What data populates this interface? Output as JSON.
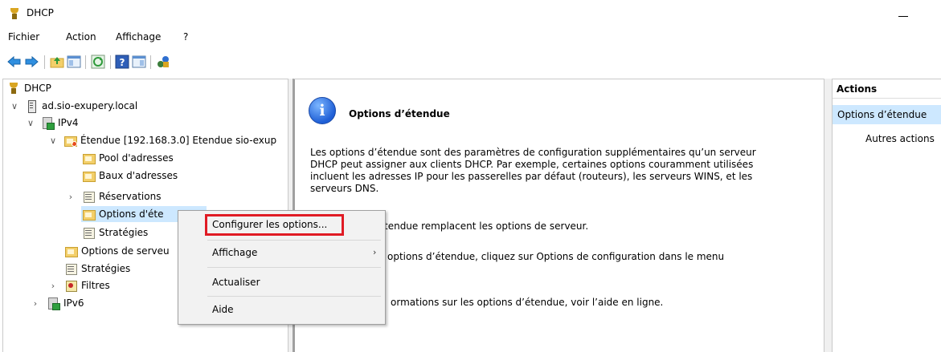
{
  "window": {
    "title": "DHCP"
  },
  "menu": [
    "Fichier",
    "Action",
    "Affichage",
    "?"
  ],
  "tree": {
    "root": "DHCP",
    "server": "ad.sio-exupery.local",
    "ipv4": "IPv4",
    "scope": "Étendue [192.168.3.0] Etendue sio-exup",
    "pool": "Pool d'adresses",
    "leases": "Baux d'adresses",
    "reservations": "Réservations",
    "scope_options": "Options d'éte",
    "scope_policies": "Stratégies",
    "server_options": "Options de serveu",
    "policies": "Stratégies",
    "filters": "Filtres",
    "ipv6": "IPv6"
  },
  "main": {
    "title": "Options d’étendue",
    "para1": [
      "Les options d’étendue sont des paramètres de configuration supplémentaires qu’un serveur",
      "DHCP peut assigner aux clients DHCP. Par exemple, certaines options couramment utilisées",
      "incluent les adresses IP pour les passerelles par défaut (routeurs), les serveurs WINS, et les",
      "serveurs DNS."
    ],
    "para2": "tendue remplacent les options de serveur.",
    "para3": "options d’étendue, cliquez sur Options de configuration dans le menu",
    "para4": "ormations sur les options d’étendue, voir l’aide en ligne."
  },
  "actions": {
    "header": "Actions",
    "selected": "Options d’étendue",
    "more": "Autres actions"
  },
  "context_menu": {
    "configure": "Configurer les options...",
    "view": "Affichage",
    "refresh": "Actualiser",
    "help": "Aide"
  },
  "colors": {
    "selection": "#cde8ff",
    "highlight_box": "#e01b24",
    "menu_bg": "#f2f2f2"
  }
}
